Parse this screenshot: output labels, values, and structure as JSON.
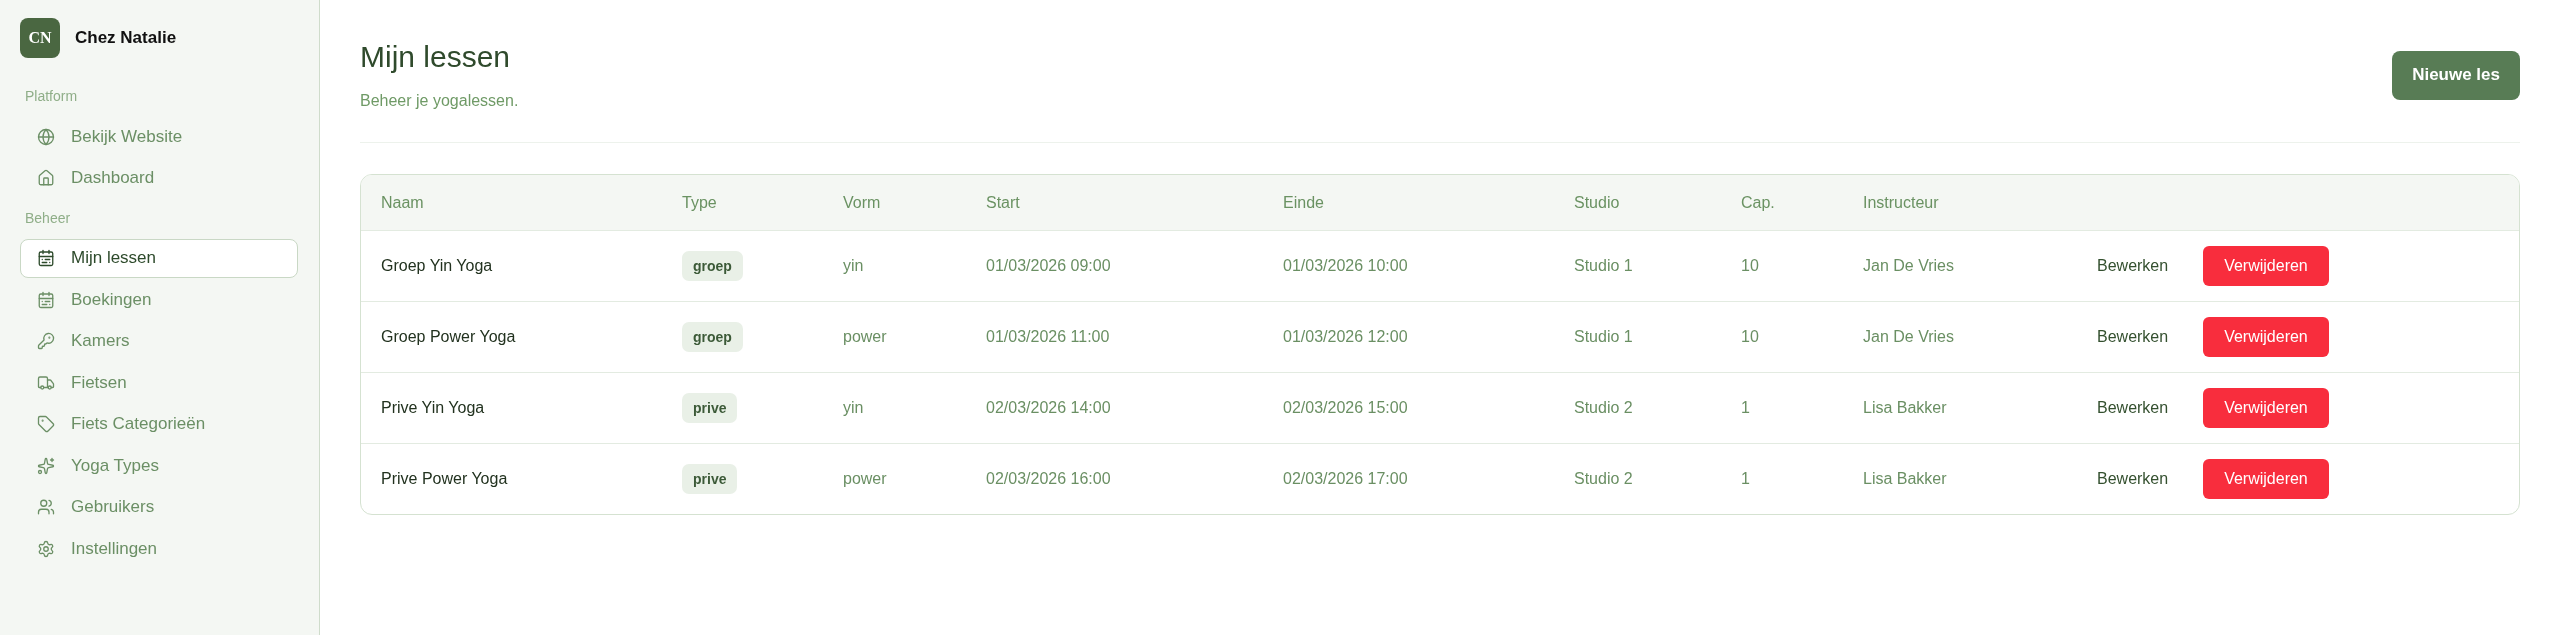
{
  "sidebar": {
    "logo": "CN",
    "brand": "Chez Natalie",
    "sections": [
      {
        "label": "Platform",
        "items": [
          {
            "label": "Bekijk Website",
            "selected": false
          },
          {
            "label": "Dashboard",
            "selected": false
          }
        ]
      },
      {
        "label": "Beheer",
        "items": [
          {
            "label": "Mijn lessen",
            "selected": true
          },
          {
            "label": "Boekingen",
            "selected": false
          },
          {
            "label": "Kamers",
            "selected": false
          },
          {
            "label": "Fietsen",
            "selected": false
          },
          {
            "label": "Fiets Categorieën",
            "selected": false
          },
          {
            "label": "Yoga Types",
            "selected": false
          },
          {
            "label": "Gebruikers",
            "selected": false
          },
          {
            "label": "Instellingen",
            "selected": false
          }
        ]
      }
    ]
  },
  "header": {
    "title": "Mijn lessen",
    "subtitle": "Beheer je yogalessen.",
    "button": "Nieuwe les"
  },
  "table": {
    "columns": [
      "Naam",
      "Type",
      "Vorm",
      "Start",
      "Einde",
      "Studio",
      "Cap.",
      "Instructeur"
    ],
    "rows": [
      {
        "naam": "Groep Yin Yoga",
        "type": "groep",
        "vorm": "yin",
        "start": "01/03/2026 09:00",
        "einde": "01/03/2026 10:00",
        "studio": "Studio 1",
        "cap": "10",
        "instructeur": "Jan De Vries",
        "actions": [
          {
            "kind": "edit",
            "label": "Bewerken"
          },
          {
            "kind": "delete",
            "label": "Verwijderen"
          }
        ]
      },
      {
        "naam": "Groep Power Yoga",
        "type": "groep",
        "vorm": "power",
        "start": "01/03/2026 11:00",
        "einde": "01/03/2026 12:00",
        "studio": "Studio 1",
        "cap": "10",
        "instructeur": "Jan De Vries",
        "actions": [
          {
            "kind": "edit",
            "label": "Bewerken"
          },
          {
            "kind": "delete",
            "label": "Verwijderen"
          }
        ]
      },
      {
        "naam": "Prive Yin Yoga",
        "type": "prive",
        "vorm": "yin",
        "start": "02/03/2026 14:00",
        "einde": "02/03/2026 15:00",
        "studio": "Studio 2",
        "cap": "1",
        "instructeur": "Lisa Bakker",
        "actions": [
          {
            "kind": "edit",
            "label": "Bewerken"
          },
          {
            "kind": "delete",
            "label": "Verwijderen"
          }
        ]
      },
      {
        "naam": "Prive Power Yoga",
        "type": "prive",
        "vorm": "power",
        "start": "02/03/2026 16:00",
        "einde": "02/03/2026 17:00",
        "studio": "Studio 2",
        "cap": "1",
        "instructeur": "Lisa Bakker",
        "actions": [
          {
            "kind": "edit",
            "label": "Bewerken"
          },
          {
            "kind": "delete",
            "label": "Verwijderen"
          }
        ]
      }
    ]
  }
}
